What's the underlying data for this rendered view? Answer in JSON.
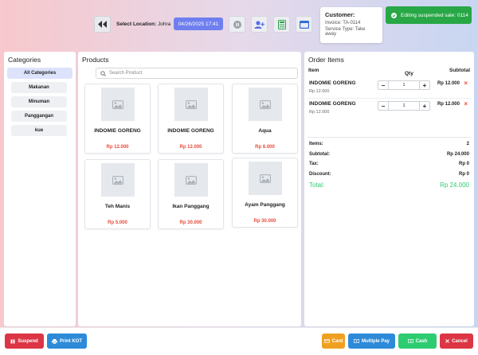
{
  "header": {
    "location_label": "Select Location:",
    "location_value": "Johra",
    "datetime": "04/26/2025 17:41",
    "customer": {
      "title": "Customer:",
      "invoice": "Invoice: TA-0114",
      "service_type": "Service Type: Take away"
    },
    "toast": "Editing suspended sale: 0114"
  },
  "categories": {
    "title": "Categories",
    "items": [
      "All Categories",
      "Makanan",
      "Minuman",
      "Panggangan",
      "kue"
    ]
  },
  "products": {
    "title": "Products",
    "search_placeholder": "Search Product",
    "items": [
      {
        "name": "INDOMIE GORENG",
        "price": "Rp 12.000"
      },
      {
        "name": "INDOMIE GORENG",
        "price": "Rp 12.000"
      },
      {
        "name": "Aqua",
        "price": "Rp 6.000"
      },
      {
        "name": "Teh Manis",
        "price": "Rp 5.000"
      },
      {
        "name": "Ikan Panggang",
        "price": "Rp 30.000"
      },
      {
        "name": "Ayam Panggang",
        "price": "Rp 30.000"
      }
    ]
  },
  "order": {
    "title": "Order Items",
    "col_item": "Item",
    "col_qty": "Qty",
    "col_subtotal": "Subtotal",
    "rows": [
      {
        "name": "INDOMIE GORENG",
        "price": "Rp 12.000",
        "qty": "1",
        "subtotal": "Rp 12.000"
      },
      {
        "name": "INDOMIE GORENG",
        "price": "Rp 12.000",
        "qty": "1",
        "subtotal": "Rp 12.000"
      }
    ],
    "totals": {
      "items_label": "Items:",
      "items_value": "2",
      "subtotal_label": "Subtotal:",
      "subtotal_value": "Rp 24.000",
      "tax_label": "Tax:",
      "tax_value": "Rp 0",
      "discount_label": "Discount:",
      "discount_value": "Rp 0",
      "total_label": "Total:",
      "total_value": "Rp 24.000"
    }
  },
  "actions": {
    "suspend": "Suspend",
    "print_kot": "Print KOT",
    "card": "Card",
    "multiple_pay": "Multiple Pay",
    "cash": "Cash",
    "cancel": "Cancel"
  },
  "colors": {
    "accent": "#6f7ff0",
    "success": "#27a745",
    "danger": "#dc3545",
    "info": "#2d8ad8",
    "warning": "#f0a020",
    "price_red": "#e74c3c",
    "total_green": "#2ecc71"
  }
}
